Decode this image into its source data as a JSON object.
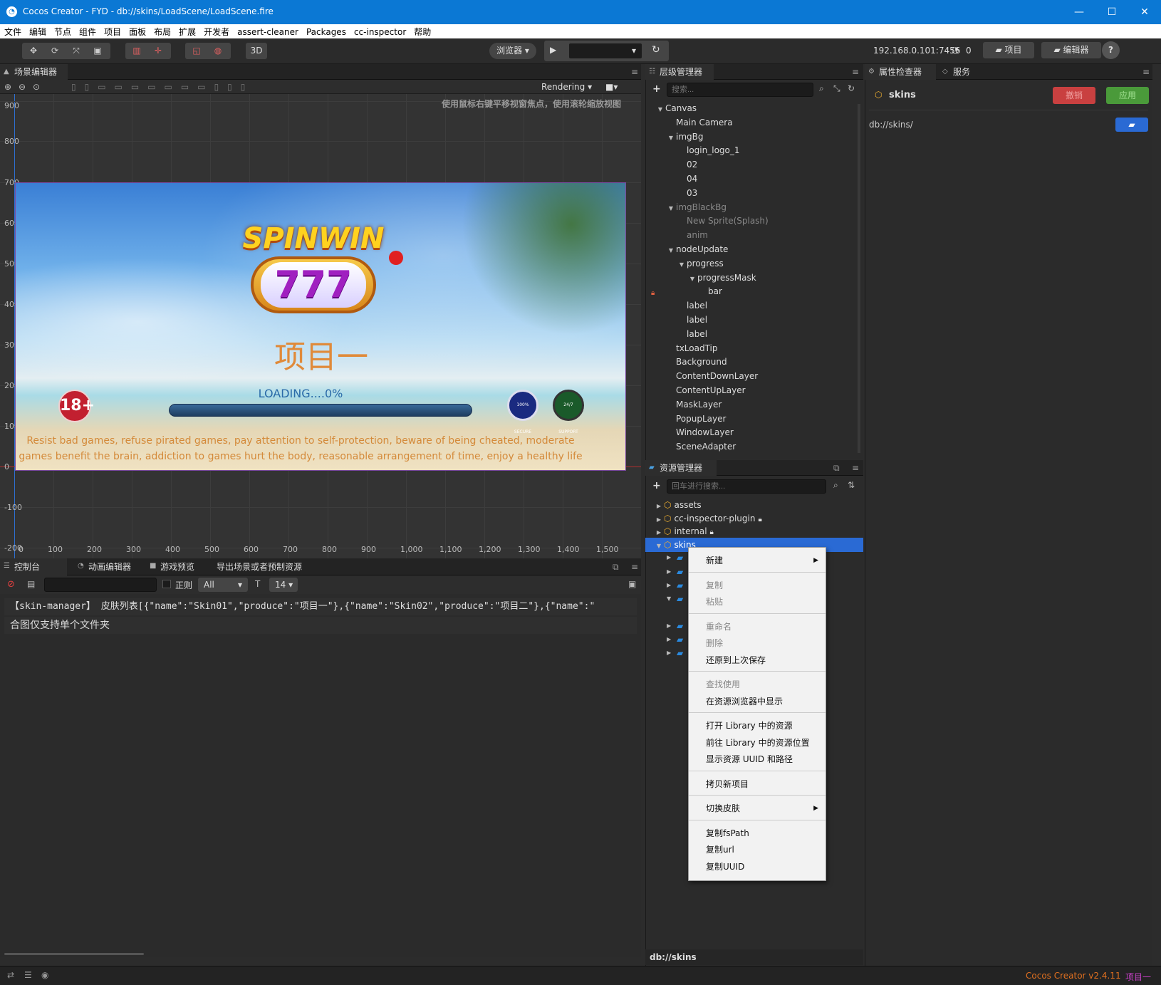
{
  "window": {
    "title": "Cocos Creator - FYD - db://skins/LoadScene/LoadScene.fire",
    "minimize": "—",
    "maximize": "☐",
    "close": "✕"
  },
  "menubar": {
    "items": [
      "文件",
      "编辑",
      "节点",
      "组件",
      "项目",
      "面板",
      "布局",
      "扩展",
      "开发者",
      "assert-cleaner",
      "Packages",
      "cc-inspector",
      "帮助"
    ]
  },
  "toolbar": {
    "btn_3d": "3D",
    "browser_select": "浏览器 ▾",
    "play": "▶",
    "device_select": "▾",
    "refresh": "↻",
    "ip": "192.168.0.101:7456",
    "conn_count": "0",
    "project_btn": "项目",
    "editor_btn": "编辑器",
    "help": "?"
  },
  "scene_editor": {
    "tab": "场景编辑器",
    "rendering": "Rendering",
    "hint": "使用鼠标右键平移视窗焦点，使用滚轮缩放视图",
    "y_labels": [
      "900",
      "800",
      "700",
      "600",
      "500",
      "400",
      "300",
      "200",
      "100",
      "0",
      "-100",
      "-200"
    ],
    "x_labels": [
      "0",
      "100",
      "200",
      "300",
      "400",
      "500",
      "600",
      "700",
      "800",
      "900",
      "1,000",
      "1,100",
      "1,200",
      "1,300",
      "1,400",
      "1,500"
    ],
    "game": {
      "logo_top": "SPINWIN",
      "logo_num": "777",
      "title": "项目一",
      "loading": "LOADING....0%",
      "progress": 0,
      "age_badge": "18+",
      "secure_badge": "100% SECURE",
      "support_badge": "24/7 SUPPORT",
      "notice_line1": "Resist bad games, refuse pirated games, pay attention to self-protection, beware of being cheated, moderate",
      "notice_line2": "games benefit the brain, addiction to games hurt the body, reasonable arrangement of time, enjoy a healthy life"
    }
  },
  "hierarchy": {
    "tab": "层级管理器",
    "search_placeholder": "搜索...",
    "nodes": [
      {
        "label": "Canvas",
        "indent": 0,
        "arrow": "▼",
        "dim": false
      },
      {
        "label": "Main Camera",
        "indent": 1,
        "arrow": "",
        "dim": false
      },
      {
        "label": "imgBg",
        "indent": 1,
        "arrow": "▼",
        "dim": false
      },
      {
        "label": "login_logo_1",
        "indent": 2,
        "arrow": "",
        "dim": false
      },
      {
        "label": "02",
        "indent": 2,
        "arrow": "",
        "dim": false
      },
      {
        "label": "04",
        "indent": 2,
        "arrow": "",
        "dim": false
      },
      {
        "label": "03",
        "indent": 2,
        "arrow": "",
        "dim": false
      },
      {
        "label": "imgBlackBg",
        "indent": 1,
        "arrow": "▼",
        "dim": true
      },
      {
        "label": "New Sprite(Splash)",
        "indent": 2,
        "arrow": "",
        "dim": true
      },
      {
        "label": "anim",
        "indent": 2,
        "arrow": "",
        "dim": true
      },
      {
        "label": "nodeUpdate",
        "indent": 1,
        "arrow": "▼",
        "dim": false
      },
      {
        "label": "progress",
        "indent": 2,
        "arrow": "▼",
        "dim": false
      },
      {
        "label": "progressMask",
        "indent": 3,
        "arrow": "▼",
        "dim": false
      },
      {
        "label": "bar",
        "indent": 4,
        "arrow": "",
        "dim": false
      },
      {
        "label": "label",
        "indent": 2,
        "arrow": "",
        "dim": false
      },
      {
        "label": "label",
        "indent": 2,
        "arrow": "",
        "dim": false
      },
      {
        "label": "label",
        "indent": 2,
        "arrow": "",
        "dim": false
      },
      {
        "label": "txLoadTip",
        "indent": 1,
        "arrow": "",
        "dim": false
      },
      {
        "label": "Background",
        "indent": 1,
        "arrow": "",
        "dim": false
      },
      {
        "label": "ContentDownLayer",
        "indent": 1,
        "arrow": "",
        "dim": false
      },
      {
        "label": "ContentUpLayer",
        "indent": 1,
        "arrow": "",
        "dim": false
      },
      {
        "label": "MaskLayer",
        "indent": 1,
        "arrow": "",
        "dim": false
      },
      {
        "label": "PopupLayer",
        "indent": 1,
        "arrow": "",
        "dim": false
      },
      {
        "label": "WindowLayer",
        "indent": 1,
        "arrow": "",
        "dim": false
      },
      {
        "label": "SceneAdapter",
        "indent": 1,
        "arrow": "",
        "dim": false
      }
    ]
  },
  "assets": {
    "tab": "资源管理器",
    "search_placeholder": "回车进行搜索...",
    "items": [
      {
        "label": "assets",
        "locked": false,
        "selected": false
      },
      {
        "label": "cc-inspector-plugin",
        "locked": true,
        "selected": false
      },
      {
        "label": "internal",
        "locked": true,
        "selected": false
      },
      {
        "label": "skins",
        "locked": false,
        "selected": true
      }
    ],
    "footer_path": "db://skins"
  },
  "context_menu": {
    "groups": [
      [
        {
          "label": "新建",
          "submenu": true,
          "disabled": false
        }
      ],
      [
        {
          "label": "复制",
          "disabled": true
        },
        {
          "label": "粘贴",
          "disabled": true
        }
      ],
      [
        {
          "label": "重命名",
          "disabled": true
        },
        {
          "label": "删除",
          "disabled": true
        },
        {
          "label": "还原到上次保存",
          "disabled": false
        }
      ],
      [
        {
          "label": "查找使用",
          "disabled": true
        },
        {
          "label": "在资源浏览器中显示",
          "disabled": false
        }
      ],
      [
        {
          "label": "打开 Library 中的资源",
          "disabled": false
        },
        {
          "label": "前往 Library 中的资源位置",
          "disabled": false
        },
        {
          "label": "显示资源 UUID 和路径",
          "disabled": false
        }
      ],
      [
        {
          "label": "拷贝新项目",
          "disabled": false
        }
      ],
      [
        {
          "label": "切换皮肤",
          "submenu": true,
          "disabled": false
        }
      ],
      [
        {
          "label": "复制fsPath",
          "disabled": false
        },
        {
          "label": "复制url",
          "disabled": false
        },
        {
          "label": "复制UUID",
          "disabled": false
        }
      ]
    ]
  },
  "inspector": {
    "tab": "属性检查器",
    "tab2": "服务",
    "name": "skins",
    "revert_btn": "撤销",
    "apply_btn": "应用",
    "path": "db://skins/"
  },
  "console": {
    "tabs": [
      "控制台",
      "动画编辑器",
      "游戏预览",
      "导出场景或者预制资源"
    ],
    "regex_label": "正则",
    "level_select": "All",
    "font_size": "14",
    "lines": [
      "【skin-manager】 皮肤列表[{\"name\":\"Skin01\",\"produce\":\"项目一\"},{\"name\":\"Skin02\",\"produce\":\"项目二\"},{\"name\":\"",
      "合图仅支持单个文件夹"
    ]
  },
  "statusbar": {
    "version": "Cocos Creator v2.4.11",
    "project": "项目一"
  },
  "colors": {
    "accent": "#0b78d4",
    "selected": "#2a6ad4",
    "orange_title": "#e08a3a",
    "notice": "#d48a3a",
    "revert": "#c94040",
    "apply": "#4a9a3a"
  }
}
